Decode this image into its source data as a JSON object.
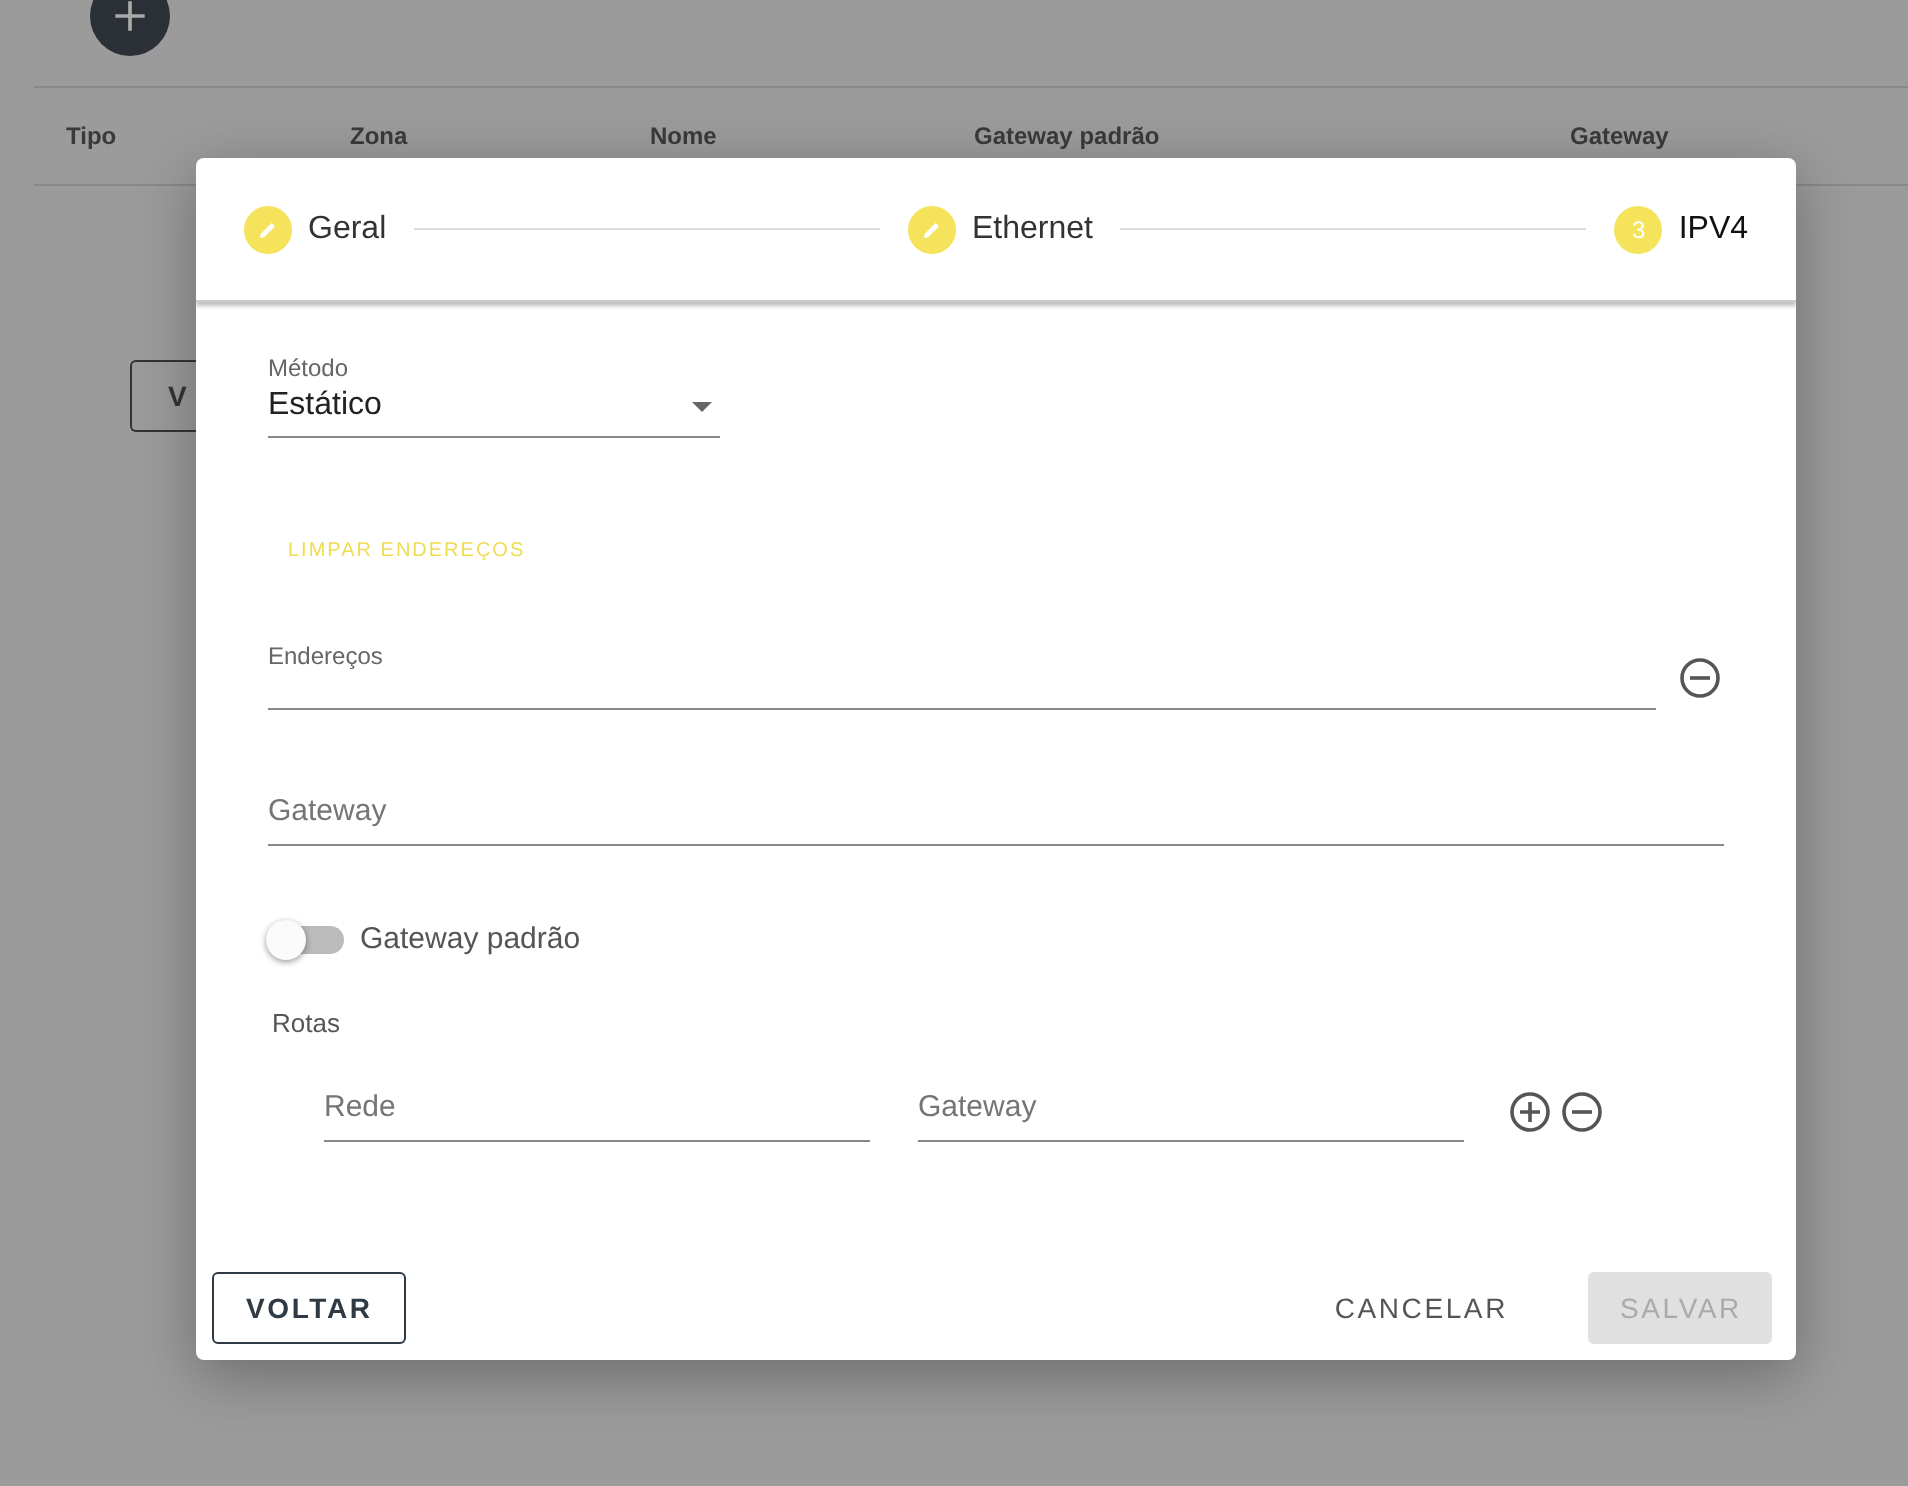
{
  "background": {
    "table": {
      "columns": [
        "Tipo",
        "Zona",
        "Nome",
        "Gateway padrão",
        "Gateway"
      ]
    },
    "back_button": {
      "label": "V"
    }
  },
  "dialog": {
    "steps": [
      {
        "label": "Geral",
        "completed": true,
        "selected": false
      },
      {
        "label": "Ethernet",
        "completed": true,
        "selected": false
      },
      {
        "label": "IPV4",
        "completed": false,
        "selected": true,
        "number": "3"
      }
    ],
    "method": {
      "label": "Método",
      "value": "Estático"
    },
    "clear_button": {
      "label": "LIMPAR ENDEREÇOS"
    },
    "addresses": {
      "label": "Endereços"
    },
    "gateway": {
      "placeholder": "Gateway"
    },
    "default_gateway": {
      "label": "Gateway padrão",
      "on": false
    },
    "routes": {
      "title": "Rotas",
      "rows": [
        {
          "network": {
            "placeholder": "Rede"
          },
          "gateway": {
            "placeholder": "Gateway"
          }
        }
      ]
    },
    "buttons": {
      "back": "VOLTAR",
      "cancel": "CANCELAR",
      "save": {
        "label": "SALVAR",
        "disabled": true
      }
    }
  }
}
